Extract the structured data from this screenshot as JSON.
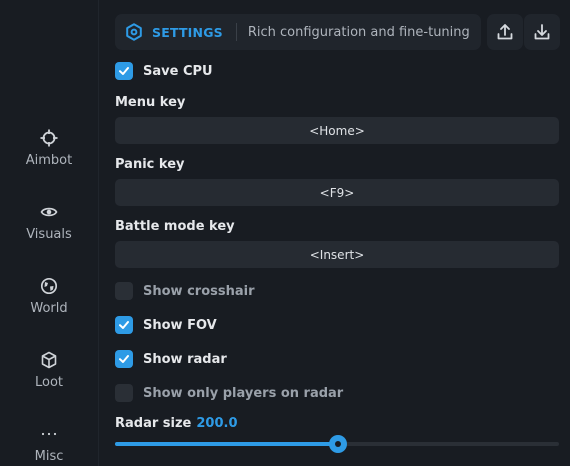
{
  "sidebar": {
    "items": [
      {
        "label": "Aimbot",
        "icon": "crosshair-icon"
      },
      {
        "label": "Visuals",
        "icon": "eye-icon"
      },
      {
        "label": "World",
        "icon": "globe-icon"
      },
      {
        "label": "Loot",
        "icon": "cube-icon"
      },
      {
        "label": "Misc",
        "icon": "more-dots-icon"
      }
    ]
  },
  "header": {
    "title": "SETTINGS",
    "subtitle": "Rich configuration and fine-tuning",
    "icon": "hex-gear-icon",
    "accent": "#2e9be6"
  },
  "toolbar": {
    "upload_icon": "upload-icon",
    "download_icon": "download-icon"
  },
  "settings": {
    "save_cpu": {
      "label": "Save CPU",
      "checked": true
    },
    "menu_key": {
      "label": "Menu key",
      "value": "<Home>"
    },
    "panic_key": {
      "label": "Panic key",
      "value": "<F9>"
    },
    "battle_mode_key": {
      "label": "Battle mode key",
      "value": "<Insert>"
    },
    "show_crosshair": {
      "label": "Show crosshair",
      "checked": false
    },
    "show_fov": {
      "label": "Show FOV",
      "checked": true
    },
    "show_radar": {
      "label": "Show radar",
      "checked": true
    },
    "show_only_players_on_radar": {
      "label": "Show only players on radar",
      "checked": false
    },
    "radar_size": {
      "label": "Radar size",
      "value": "200.0",
      "fraction": 0.503
    }
  }
}
